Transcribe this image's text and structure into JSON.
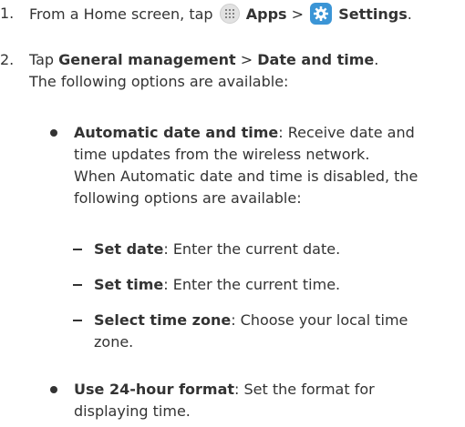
{
  "steps": [
    {
      "number": "1.",
      "pre": "From a Home screen, tap ",
      "apps_label": "Apps",
      "separator": " > ",
      "settings_label": "Settings",
      "post": ".",
      "apps_icon": "apps-grid-icon",
      "settings_icon": "gear-icon"
    },
    {
      "number": "2.",
      "pre": "Tap ",
      "general_label": "General management",
      "separator": " > ",
      "date_label": "Date and time",
      "post": ".",
      "line2": "The following options are available:"
    }
  ],
  "options": [
    {
      "title": "Automatic date and time",
      "line1": ": Receive date and",
      "line2": "time updates from the wireless network.",
      "line3": "When Automatic date and time is disabled, the",
      "line4": "following options are available:"
    },
    {
      "title": "Use 24-hour format",
      "line1": ": Set the format for",
      "line2": "displaying time."
    }
  ],
  "suboptions": [
    {
      "title": "Set date",
      "text": ": Enter the current date."
    },
    {
      "title": "Set time",
      "text": ": Enter the current time."
    },
    {
      "title": "Select time zone",
      "text": ": Choose your local time",
      "line2": "zone."
    }
  ]
}
